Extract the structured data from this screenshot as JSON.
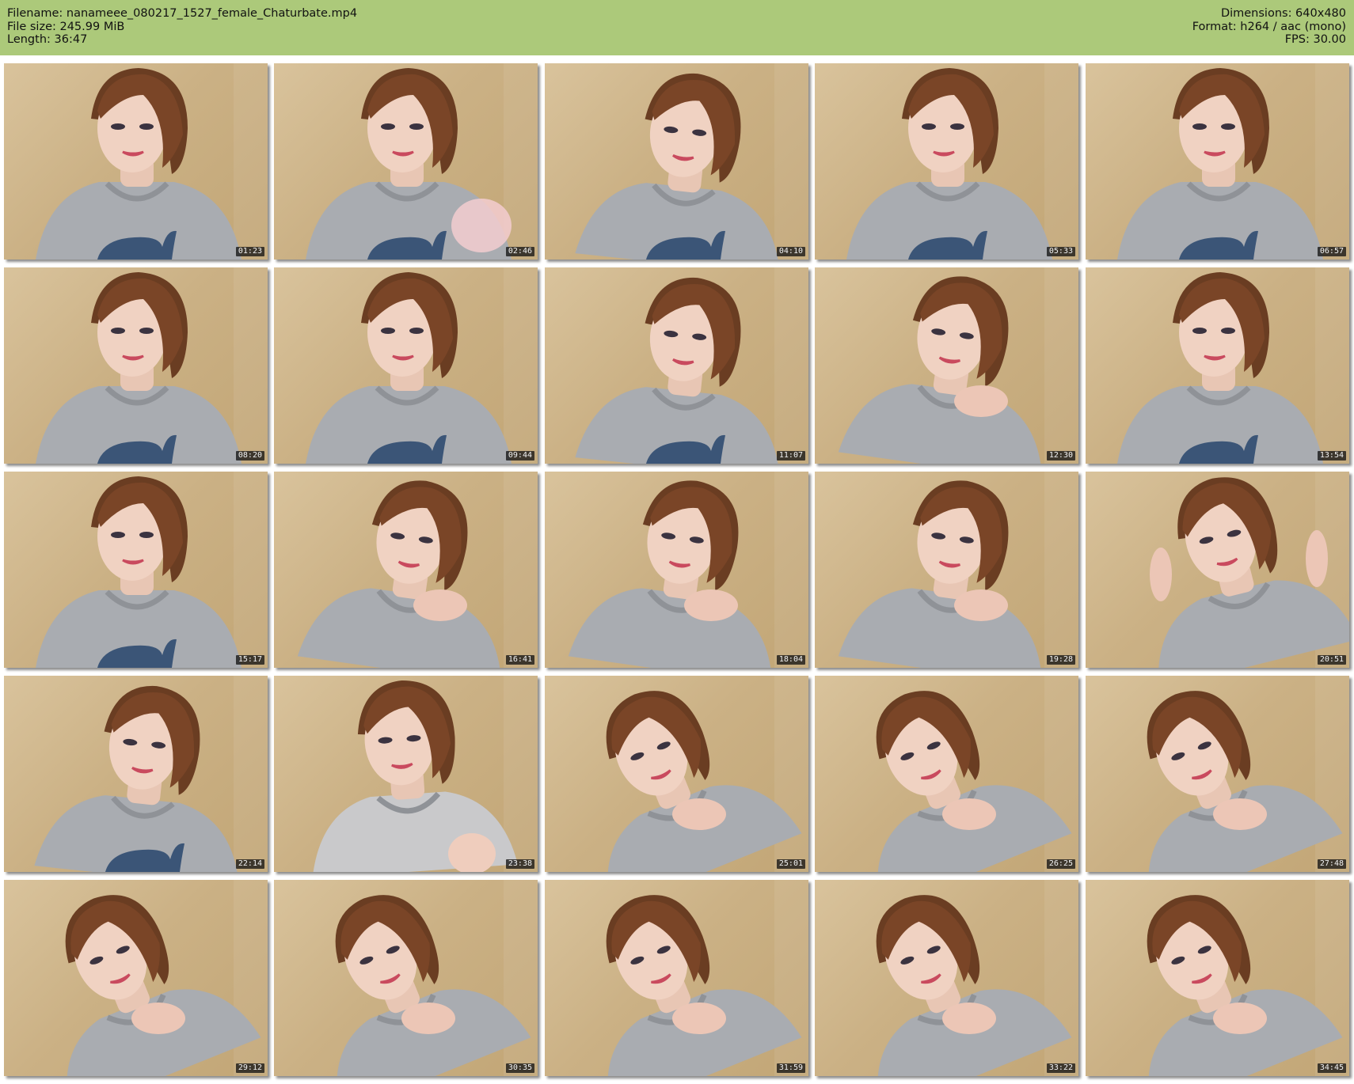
{
  "header": {
    "filename_line": "Filename: nanameee_080217_1527_female_Chaturbate.mp4",
    "filesize_line": "File size: 245.99 MiB",
    "length_line": "Length: 36:47",
    "dimensions_line": "Dimensions: 640x480",
    "format_line": "Format: h264 / aac (mono)",
    "fps_line": "FPS: 30.00",
    "background_color": "#acc97a"
  },
  "thumbnails": [
    {
      "time": "01:23",
      "pose": "front"
    },
    {
      "time": "02:46",
      "pose": "wave"
    },
    {
      "time": "04:10",
      "pose": "down"
    },
    {
      "time": "05:33",
      "pose": "front"
    },
    {
      "time": "06:57",
      "pose": "front"
    },
    {
      "time": "08:20",
      "pose": "front"
    },
    {
      "time": "09:44",
      "pose": "front"
    },
    {
      "time": "11:07",
      "pose": "down"
    },
    {
      "time": "12:30",
      "pose": "hand"
    },
    {
      "time": "13:54",
      "pose": "front"
    },
    {
      "time": "15:17",
      "pose": "front"
    },
    {
      "time": "16:41",
      "pose": "hand"
    },
    {
      "time": "18:04",
      "pose": "hand"
    },
    {
      "time": "19:28",
      "pose": "hand"
    },
    {
      "time": "20:51",
      "pose": "tilt"
    },
    {
      "time": "22:14",
      "pose": "down"
    },
    {
      "time": "23:38",
      "pose": "shoulder"
    },
    {
      "time": "25:01",
      "pose": "rest"
    },
    {
      "time": "26:25",
      "pose": "rest"
    },
    {
      "time": "27:48",
      "pose": "rest"
    },
    {
      "time": "29:12",
      "pose": "rest"
    },
    {
      "time": "30:35",
      "pose": "rest"
    },
    {
      "time": "31:59",
      "pose": "rest"
    },
    {
      "time": "33:22",
      "pose": "rest"
    },
    {
      "time": "34:45",
      "pose": "rest"
    }
  ]
}
